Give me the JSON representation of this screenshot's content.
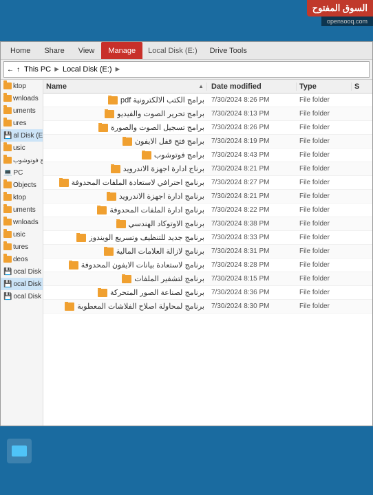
{
  "watermark": {
    "title": "السوق المفتوح",
    "subtitle": "opensooq.com"
  },
  "ribbon": {
    "tabs": [
      {
        "id": "home",
        "label": "Home"
      },
      {
        "id": "share",
        "label": "Share"
      },
      {
        "id": "view",
        "label": "View"
      },
      {
        "id": "manage",
        "label": "Manage",
        "active": true
      },
      {
        "id": "drive_tools",
        "label": "Drive Tools"
      }
    ],
    "title": "Local Disk (E:)"
  },
  "address": {
    "parts": [
      "This PC",
      "Local Disk (E:)"
    ]
  },
  "sidebar": {
    "items": [
      {
        "label": "ktop",
        "id": "desktop"
      },
      {
        "label": "wnloads",
        "id": "downloads"
      },
      {
        "label": "uments",
        "id": "documents"
      },
      {
        "label": "ures",
        "id": "pictures"
      },
      {
        "label": "al Disk (E:",
        "id": "local_e",
        "active": true
      },
      {
        "label": "usic",
        "id": "music"
      },
      {
        "label": "برامج فوتوشوب",
        "id": "photoshop"
      },
      {
        "label": "PC",
        "id": "pc"
      },
      {
        "label": "Objects",
        "id": "objects"
      },
      {
        "label": "ktop",
        "id": "desktop2"
      },
      {
        "label": "uments",
        "id": "documents2"
      },
      {
        "label": "wnloads",
        "id": "downloads2"
      },
      {
        "label": "usic",
        "id": "music2"
      },
      {
        "label": "tures",
        "id": "pictures2"
      },
      {
        "label": "deos",
        "id": "videos"
      },
      {
        "label": "ocal Disk (C:)",
        "id": "local_c"
      },
      {
        "label": "ocal Disk (E:)",
        "id": "local_e2"
      },
      {
        "label": "ocal Disk (F:)",
        "id": "local_f"
      }
    ]
  },
  "columns": {
    "name": "Name",
    "date_modified": "Date modified",
    "type": "Type",
    "size": "S"
  },
  "files": [
    {
      "name": "برامج الكتب الالكترونية pdf",
      "date": "7/30/2024 8:26 PM",
      "type": "File folder",
      "icon": "folder"
    },
    {
      "name": "برامج تحرير الصوت والفيديو",
      "date": "7/30/2024 8:13 PM",
      "type": "File folder",
      "icon": "folder"
    },
    {
      "name": "برامج تسجيل الصوت والصورة",
      "date": "7/30/2024 8:26 PM",
      "type": "File folder",
      "icon": "folder"
    },
    {
      "name": "برامج فتح قفل الايفون",
      "date": "7/30/2024 8:19 PM",
      "type": "File folder",
      "icon": "folder"
    },
    {
      "name": "برامج فوتوشوب",
      "date": "7/30/2024 8:43 PM",
      "type": "File folder",
      "icon": "folder"
    },
    {
      "name": "برناج ادارة اجهزة الاندرويد",
      "date": "7/30/2024 8:21 PM",
      "type": "File folder",
      "icon": "folder"
    },
    {
      "name": "برنامج احترافي لاستعادة الملفات المحدوفة",
      "date": "7/30/2024 8:27 PM",
      "type": "File folder",
      "icon": "folder"
    },
    {
      "name": "برنامج ادارة اجهزة الاندرويد",
      "date": "7/30/2024 8:21 PM",
      "type": "File folder",
      "icon": "folder"
    },
    {
      "name": "برنامج ادارة الملفات المحدوفة",
      "date": "7/30/2024 8:22 PM",
      "type": "File folder",
      "icon": "folder"
    },
    {
      "name": "برنامج الاوتوكاد الهندسي",
      "date": "7/30/2024 8:38 PM",
      "type": "File folder",
      "icon": "folder"
    },
    {
      "name": "برنامج جديد للتنظيف وتسريع الويندوز",
      "date": "7/30/2024 8:33 PM",
      "type": "File folder",
      "icon": "folder"
    },
    {
      "name": "برنامج لازالة العلامات المالية",
      "date": "7/30/2024 8:31 PM",
      "type": "File folder",
      "icon": "folder"
    },
    {
      "name": "برنامج لاستعادة بيانات الايفون المحدوفة",
      "date": "7/30/2024 8:28 PM",
      "type": "File folder",
      "icon": "folder"
    },
    {
      "name": "برنامج لتشفير الملفات",
      "date": "7/30/2024 8:15 PM",
      "type": "File folder",
      "icon": "folder"
    },
    {
      "name": "برنامج لصناعة الصور المتحركة",
      "date": "7/30/2024 8:36 PM",
      "type": "File folder",
      "icon": "folder"
    },
    {
      "name": "برنامج لمحاولة اصلاح الفلاشات المعطوبة",
      "date": "7/30/2024 8:30 PM",
      "type": "File folder",
      "icon": "folder"
    }
  ]
}
